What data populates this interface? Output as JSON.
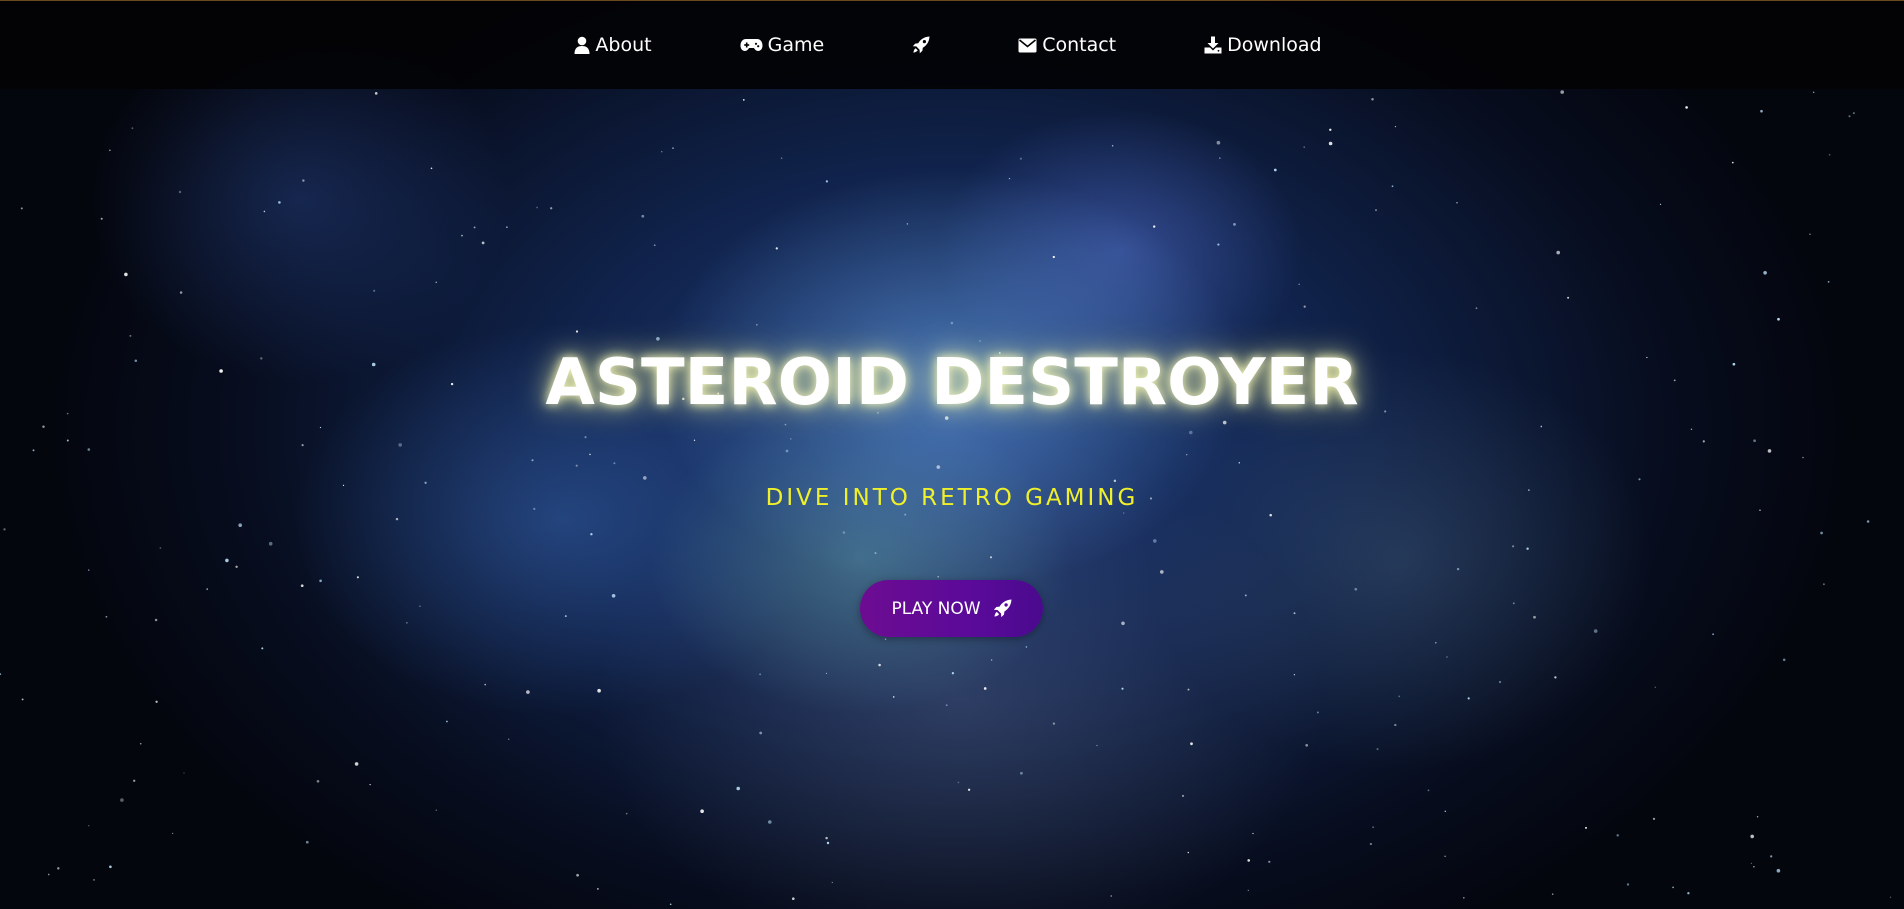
{
  "nav": {
    "items": [
      {
        "label": "About",
        "icon": "user-icon"
      },
      {
        "label": "Game",
        "icon": "gamepad-icon"
      },
      {
        "label": "",
        "icon": "rocket-icon"
      },
      {
        "label": "Contact",
        "icon": "envelope-icon"
      },
      {
        "label": "Download",
        "icon": "download-icon"
      }
    ]
  },
  "hero": {
    "title": "ASTEROID DESTROYER",
    "subtitle": "DIVE INTO RETRO GAMING",
    "cta_label": "PLAY NOW",
    "cta_icon": "rocket-icon"
  },
  "colors": {
    "nav_bg": "#030305",
    "subtitle": "#f0f02a",
    "button": "#5b0a9a",
    "title_glow": "#ffffbe"
  }
}
